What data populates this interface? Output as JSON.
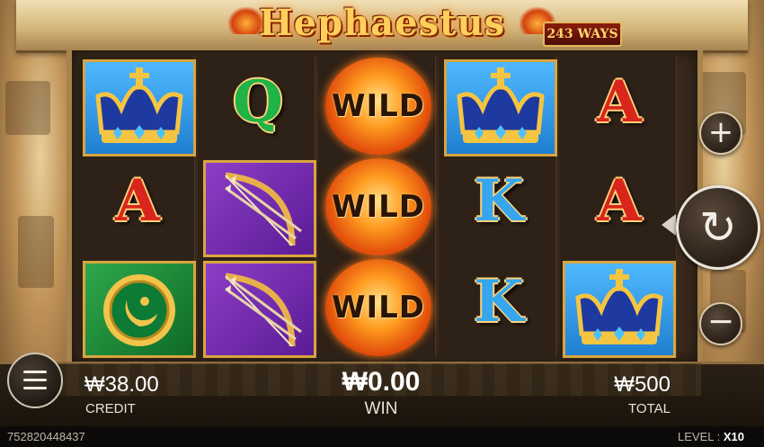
{
  "game": {
    "title": "Hephaestus",
    "ways_badge": "243 WAYS"
  },
  "reels": [
    [
      "crown",
      "letter-a",
      "shield"
    ],
    [
      "letter-q",
      "bow",
      "bow"
    ],
    [
      "wild",
      "wild",
      "wild"
    ],
    [
      "crown",
      "letter-k",
      "letter-k"
    ],
    [
      "letter-a",
      "letter-a",
      "crown"
    ]
  ],
  "symbols": {
    "wild_label": "WILD",
    "a_label": "A",
    "q_label": "Q",
    "k_label": "K"
  },
  "controls": {
    "plus_label": "+",
    "minus_label": "−",
    "spin_icon": "↻"
  },
  "panel": {
    "credit_value": "₩38.00",
    "credit_label": "CREDIT",
    "win_value": "₩0.00",
    "win_label": "WIN",
    "total_value": "₩500",
    "total_label": "TOTAL"
  },
  "footer": {
    "round_id": "752820448437",
    "level_label": "LEVEL :",
    "level_value": "X10"
  },
  "colors": {
    "accent_gold": "#d9a53f",
    "letter_a": "#d8261c",
    "letter_q": "#1fb348",
    "letter_k": "#36a6ee"
  }
}
